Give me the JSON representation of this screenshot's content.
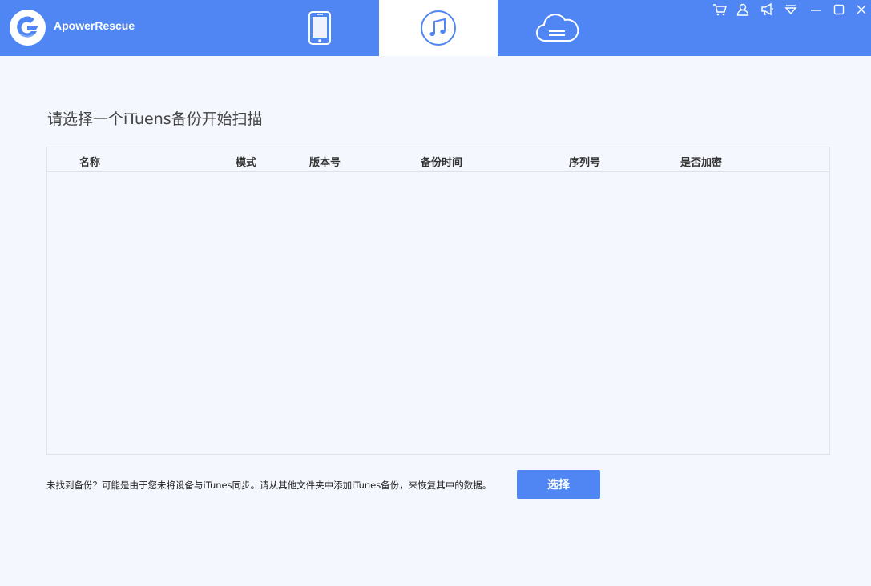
{
  "app": {
    "name": "ApowerRescue"
  },
  "colors": {
    "accent": "#4f86f3",
    "background": "#f4f7fd",
    "active_tab": "#ffffff"
  },
  "tabs": [
    {
      "icon": "phone-icon",
      "active": false
    },
    {
      "icon": "music-note-icon",
      "active": true
    },
    {
      "icon": "cloud-icon",
      "active": false
    }
  ],
  "window_controls": [
    "cart-icon",
    "user-icon",
    "megaphone-icon",
    "dropdown-menu-icon",
    "minimize-icon",
    "maximize-icon",
    "close-icon"
  ],
  "main": {
    "title": "请选择一个iTuens备份开始扫描",
    "table": {
      "columns": [
        "名称",
        "模式",
        "版本号",
        "备份时间",
        "序列号",
        "是否加密"
      ],
      "rows": []
    },
    "hint": "未找到备份？可能是由于您未将设备与iTunes同步。请从其他文件夹中添加iTunes备份，来恢复其中的数据。",
    "select_button": "选择"
  }
}
